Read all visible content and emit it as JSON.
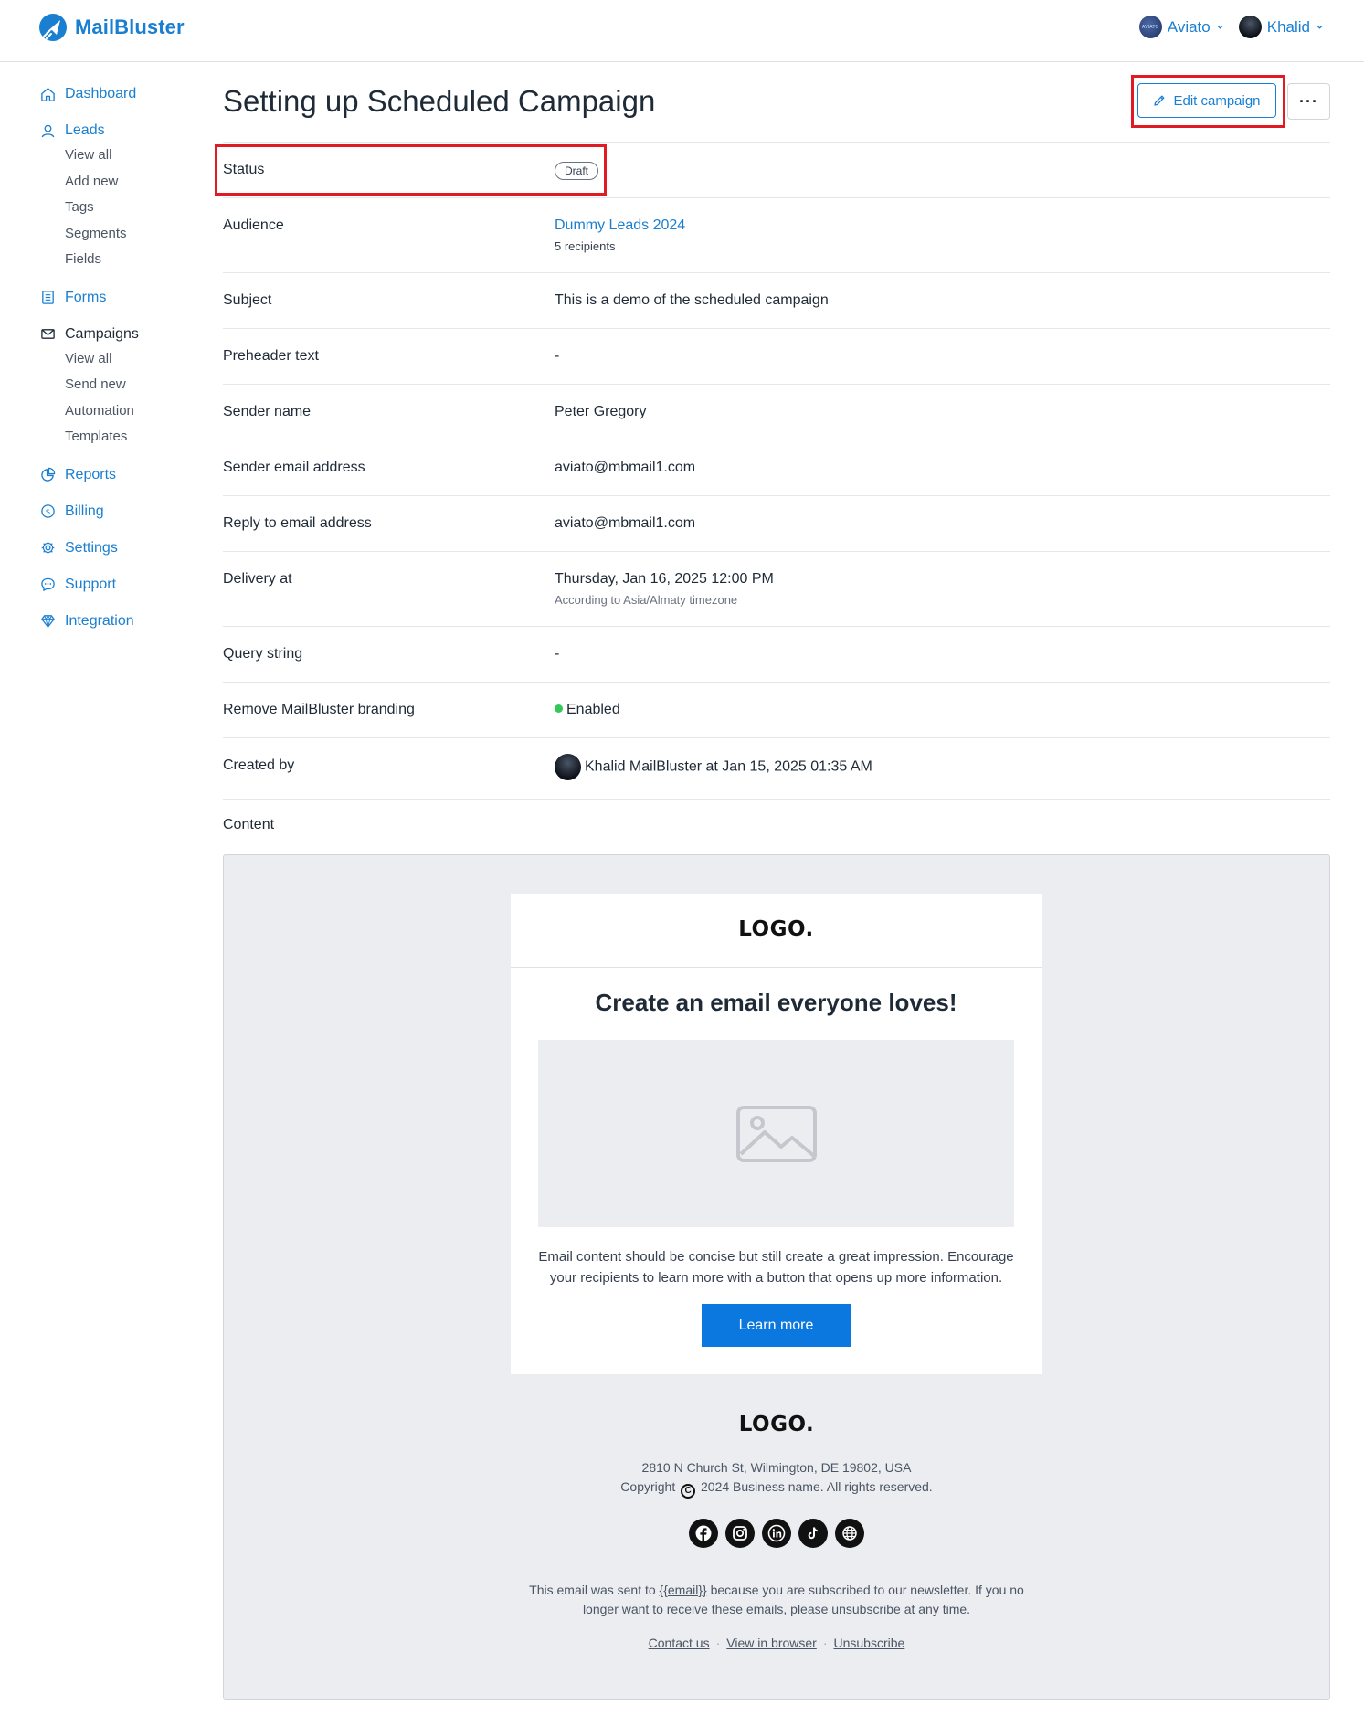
{
  "header": {
    "brand": "MailBluster",
    "org": {
      "label": "Aviato",
      "avatar_text": "AVIATO"
    },
    "user": {
      "label": "Khalid"
    }
  },
  "sidebar": {
    "dashboard": "Dashboard",
    "leads": {
      "label": "Leads",
      "items": [
        "View all",
        "Add new",
        "Tags",
        "Segments",
        "Fields"
      ]
    },
    "forms": "Forms",
    "campaigns": {
      "label": "Campaigns",
      "items": [
        "View all",
        "Send new",
        "Automation",
        "Templates"
      ]
    },
    "reports": "Reports",
    "billing": "Billing",
    "settings": "Settings",
    "support": "Support",
    "integration": "Integration"
  },
  "page": {
    "title": "Setting up Scheduled Campaign",
    "edit_button": "Edit campaign",
    "more_button": "···"
  },
  "details": {
    "status": {
      "label": "Status",
      "value": "Draft"
    },
    "audience": {
      "label": "Audience",
      "value": "Dummy Leads 2024",
      "sub": "5 recipients"
    },
    "subject": {
      "label": "Subject",
      "value": "This is a demo of the scheduled campaign"
    },
    "preheader": {
      "label": "Preheader text",
      "value": "-"
    },
    "sender_name": {
      "label": "Sender name",
      "value": "Peter Gregory"
    },
    "sender_email": {
      "label": "Sender email address",
      "value": "aviato@mbmail1.com"
    },
    "reply_to": {
      "label": "Reply to email address",
      "value": "aviato@mbmail1.com"
    },
    "delivery": {
      "label": "Delivery at",
      "value": "Thursday, Jan 16, 2025 12:00 PM",
      "sub": "According to Asia/Almaty timezone"
    },
    "query": {
      "label": "Query string",
      "value": "-"
    },
    "branding": {
      "label": "Remove MailBluster branding",
      "value": "Enabled",
      "status_color": "#34c759"
    },
    "created": {
      "label": "Created by",
      "value": "Khalid MailBluster at Jan 15, 2025 01:35 AM"
    },
    "content": {
      "label": "Content"
    }
  },
  "email": {
    "logo": "LOGO.",
    "heading": "Create an email everyone loves!",
    "body": "Email content should be concise but still create a great impression. Encourage your recipients to learn more with a button that opens up more information.",
    "button": "Learn more",
    "footer_logo": "LOGO.",
    "address": "2810 N Church St, Wilmington, DE 19802, USA",
    "copyright_prefix": "Copyright",
    "copyright_suffix": "2024 Business name. All rights reserved.",
    "socials": [
      "facebook-icon",
      "instagram-icon",
      "linkedin-icon",
      "tiktok-icon",
      "globe-icon"
    ],
    "note_before": "This email was sent to",
    "note_email": "{{email}}",
    "note_after": "because you are subscribed to our newsletter. If you no longer want to receive these emails, please unsubscribe at any time.",
    "links": {
      "contact": "Contact us",
      "browser": "View in browser",
      "unsubscribe": "Unsubscribe"
    }
  },
  "colors": {
    "accent": "#1a7fd1",
    "highlight": "#e01b24",
    "button": "#0b78df"
  }
}
